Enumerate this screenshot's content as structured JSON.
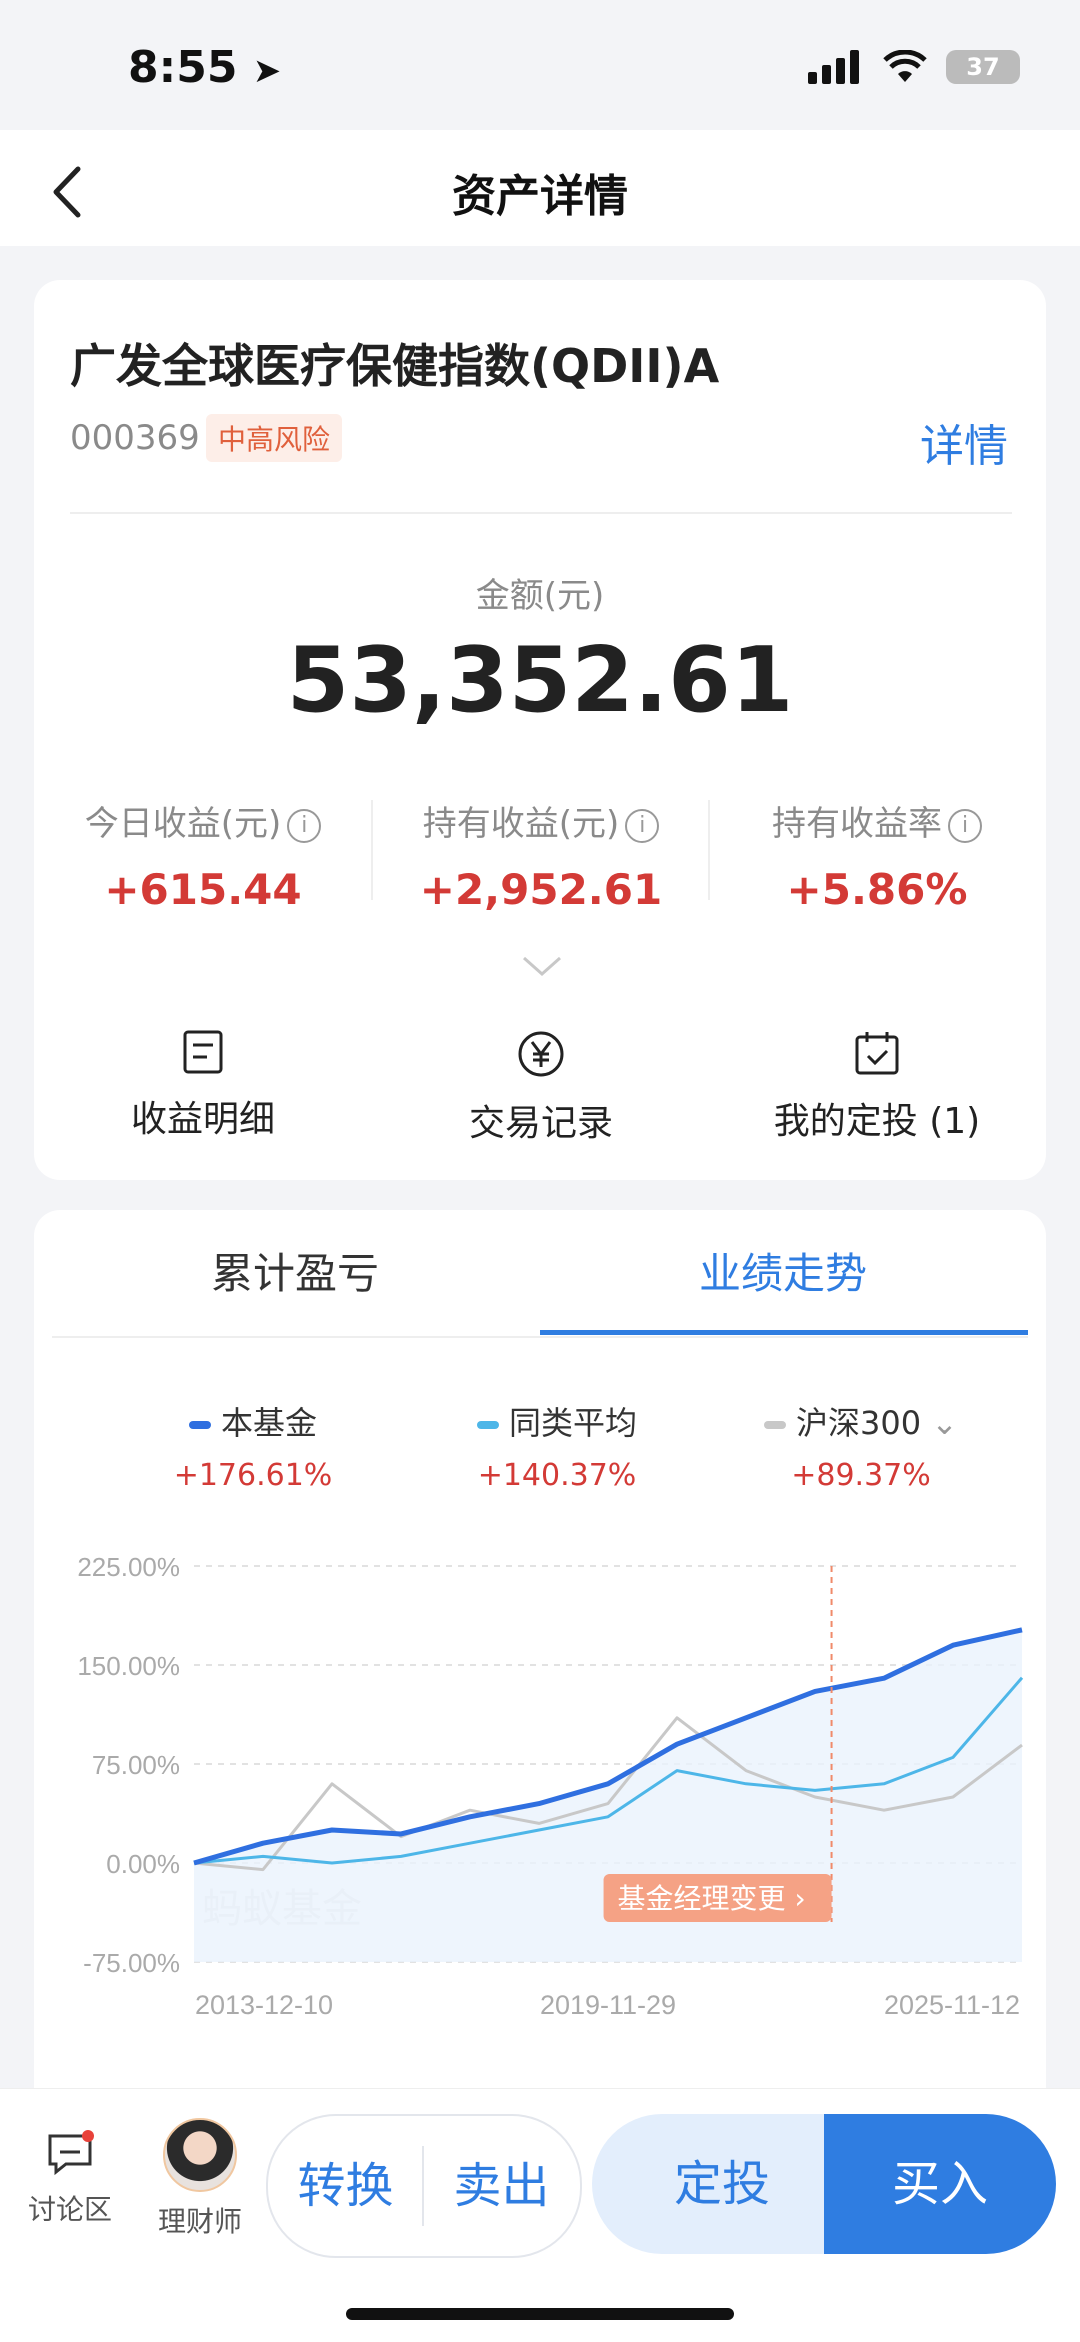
{
  "status": {
    "time": "8:55",
    "battery": "37"
  },
  "nav": {
    "title": "资产详情"
  },
  "fund": {
    "name": "广发全球医疗保健指数(QDII)A",
    "code": "000369",
    "risk": "中高风险",
    "detail_link": "详情"
  },
  "amount": {
    "label": "金额(元)",
    "value": "53,352.61"
  },
  "stats": [
    {
      "label": "今日收益(元)",
      "value": "+615.44"
    },
    {
      "label": "持有收益(元)",
      "value": "+2,952.61"
    },
    {
      "label": "持有收益率",
      "value": "+5.86%"
    }
  ],
  "actions": [
    {
      "label": "收益明细",
      "icon": "document-icon"
    },
    {
      "label": "交易记录",
      "icon": "yen-circle-icon"
    },
    {
      "label": "我的定投 (1)",
      "icon": "calendar-check-icon"
    }
  ],
  "tabs": [
    {
      "label": "累计盈亏",
      "active": false
    },
    {
      "label": "业绩走势",
      "active": true
    }
  ],
  "legend": [
    {
      "name": "本基金",
      "value": "+176.61%",
      "color": "#2f6fe0"
    },
    {
      "name": "同类平均",
      "value": "+140.37%",
      "color": "#4db6e8"
    },
    {
      "name": "沪深300",
      "value": "+89.37%",
      "color": "#c8c8c8"
    }
  ],
  "chart_data": {
    "type": "line",
    "x": [
      "2013-12-10",
      "2014-12",
      "2015-12",
      "2016-12",
      "2017-12",
      "2018-12",
      "2019-11-29",
      "2020-12",
      "2021-12",
      "2022-12",
      "2023-12",
      "2024-12",
      "2025-11-12"
    ],
    "x_tick_labels": [
      "2013-12-10",
      "2019-11-29",
      "2025-11-12"
    ],
    "y_tick_labels": [
      "225.00%",
      "150.00%",
      "75.00%",
      "0.00%",
      "-75.00%"
    ],
    "ylim": [
      -75,
      225
    ],
    "series": [
      {
        "name": "本基金",
        "values": [
          0,
          15,
          25,
          22,
          35,
          45,
          60,
          90,
          110,
          130,
          140,
          165,
          176.61
        ]
      },
      {
        "name": "同类平均",
        "values": [
          0,
          5,
          0,
          5,
          15,
          25,
          35,
          70,
          60,
          55,
          60,
          80,
          140.37
        ]
      },
      {
        "name": "沪深300",
        "values": [
          0,
          -5,
          60,
          20,
          40,
          30,
          45,
          110,
          70,
          50,
          40,
          50,
          89.37
        ]
      }
    ],
    "annotation": "基金经理变更",
    "watermark": "蚂蚁基金",
    "grid": true
  },
  "bottom": {
    "discuss": "讨论区",
    "advisor": "理财师",
    "convert": "转换",
    "sell": "卖出",
    "fixed_invest": "定投",
    "buy": "买入"
  }
}
